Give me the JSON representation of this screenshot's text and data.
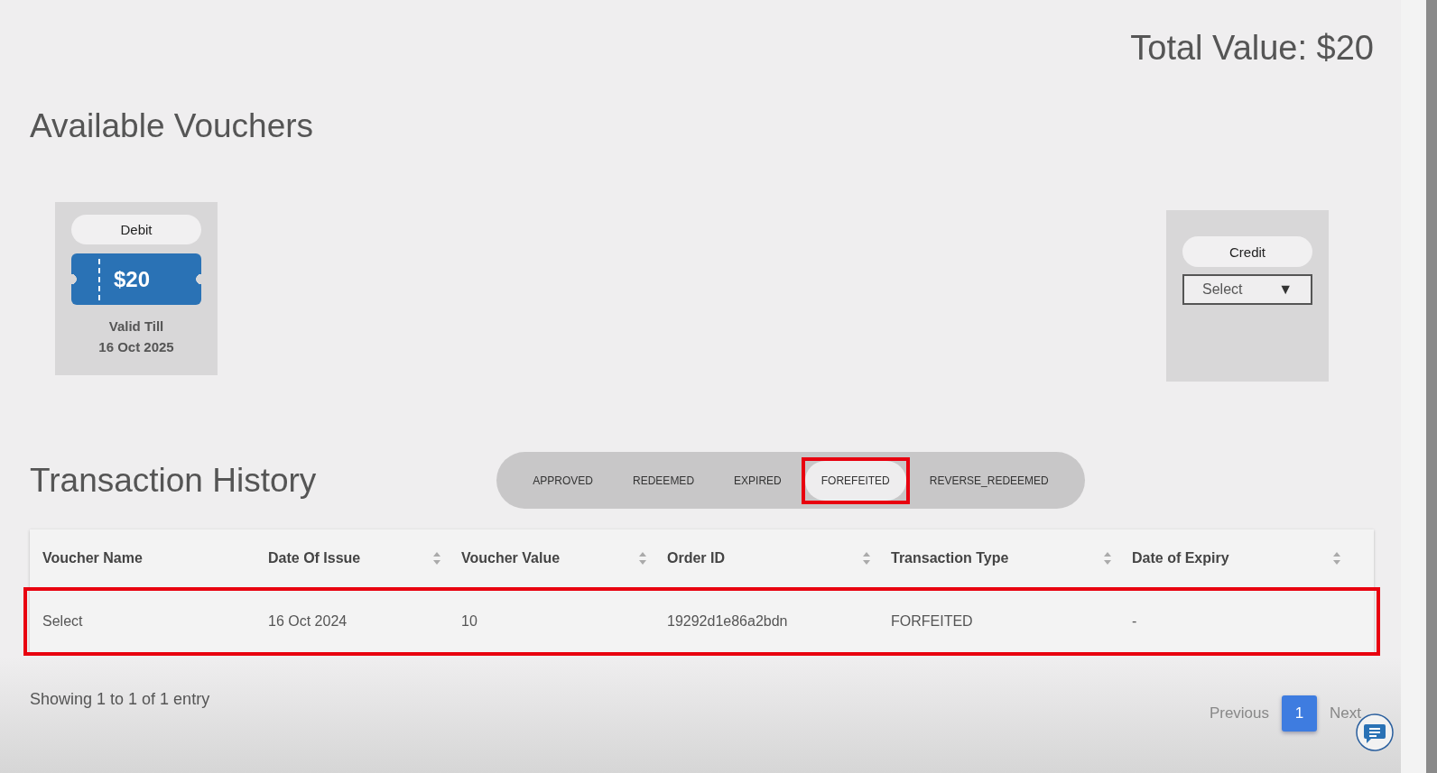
{
  "total_value": "Total Value: $20",
  "vouchers_heading": "Available Vouchers",
  "vouchers": [
    {
      "kind": "debit",
      "type_label": "Debit",
      "amount": "$20",
      "valid_label": "Valid Till",
      "valid_date": "16 Oct 2025"
    },
    {
      "kind": "credit",
      "type_label": "Credit",
      "select": "Select",
      "caret": "▼"
    }
  ],
  "history_heading": "Transaction History",
  "tabs": [
    {
      "label": "APPROVED",
      "selected": false,
      "highlighted": false
    },
    {
      "label": "REDEEMED",
      "selected": false,
      "highlighted": false
    },
    {
      "label": "EXPIRED",
      "selected": false,
      "highlighted": false
    },
    {
      "label": "FOREFEITED",
      "selected": true,
      "highlighted": true
    },
    {
      "label": "REVERSE_REDEEMED",
      "selected": false,
      "highlighted": false
    }
  ],
  "table": {
    "columns": [
      {
        "label": "Voucher Name",
        "sortable": false
      },
      {
        "label": "Date Of Issue",
        "sortable": true
      },
      {
        "label": "Voucher Value",
        "sortable": true
      },
      {
        "label": "Order ID",
        "sortable": true
      },
      {
        "label": "Transaction Type",
        "sortable": true
      },
      {
        "label": "Date of Expiry",
        "sortable": true
      }
    ],
    "rows": [
      {
        "highlighted": true,
        "cells": [
          "Select",
          "16 Oct 2024",
          "10",
          "19292d1e86a2bdn",
          "FORFEITED",
          "-"
        ]
      }
    ]
  },
  "entries_info": "Showing 1 to 1 of 1 entry",
  "pagination": {
    "previous": "Previous",
    "pages": [
      {
        "label": "1",
        "selected": true
      }
    ],
    "next": "Next"
  }
}
